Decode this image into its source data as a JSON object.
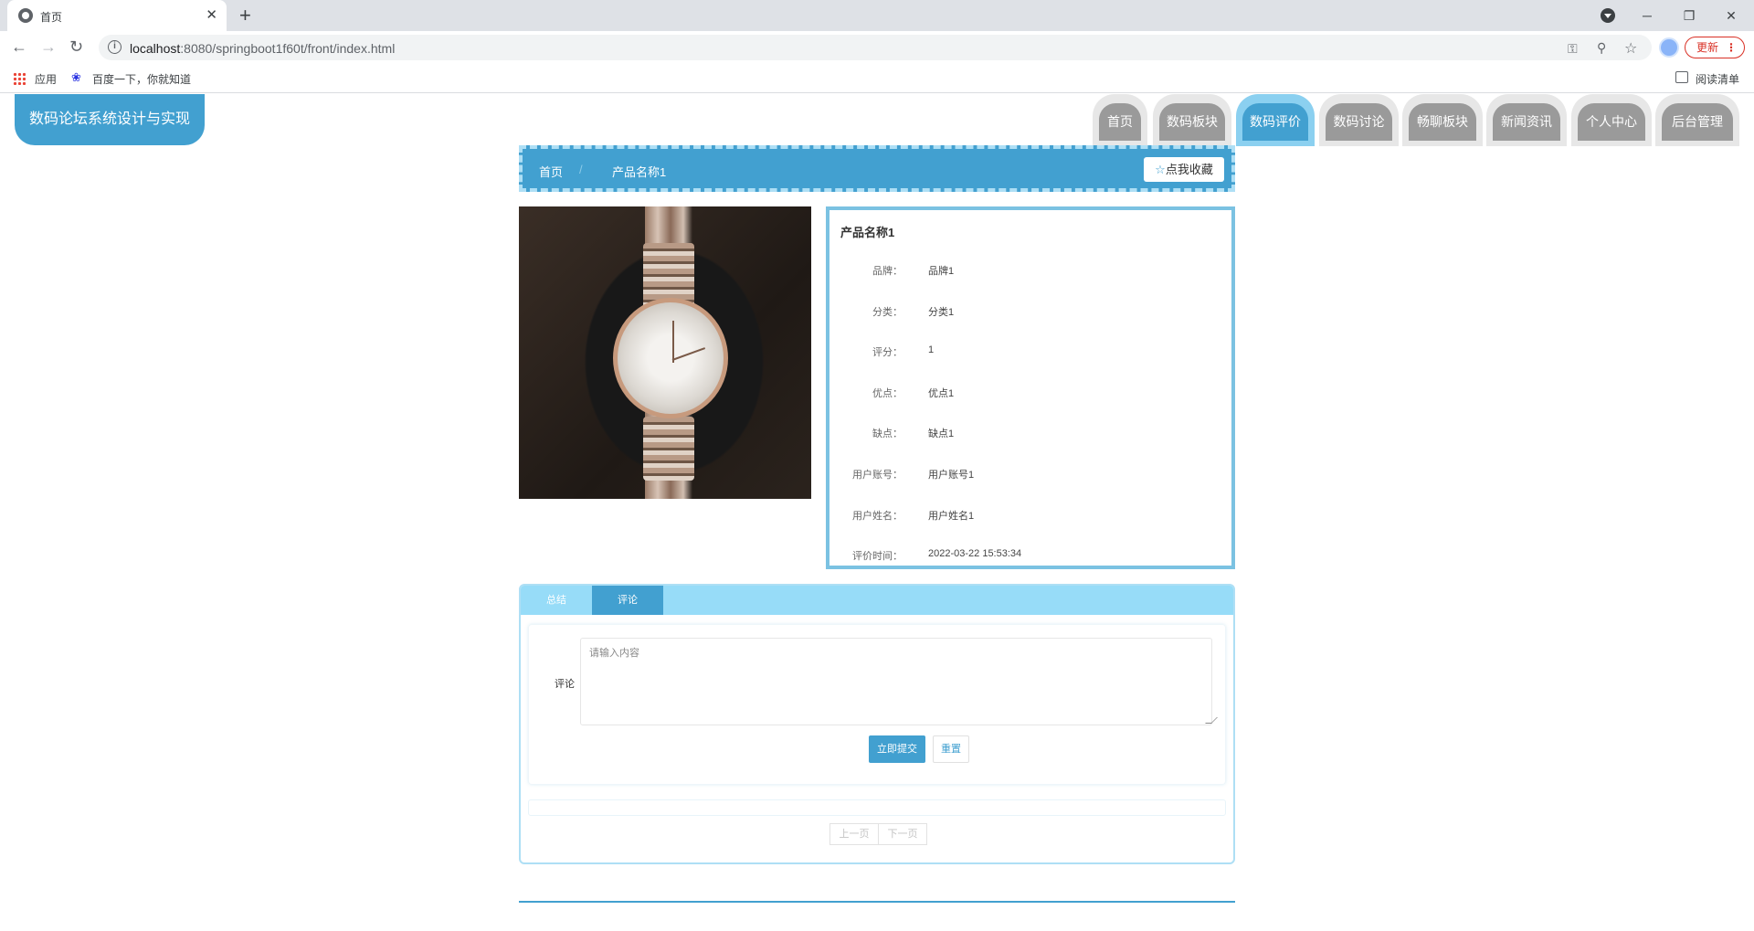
{
  "browser": {
    "tab_title": "首页",
    "url_host": "localhost",
    "url_rest": ":8080/springboot1f60t/front/index.html",
    "update_label": "更新",
    "bookmarks": [
      {
        "label": "应用"
      },
      {
        "label": "百度一下，你就知道"
      }
    ],
    "reading_list_label": "阅读清单"
  },
  "site": {
    "title": "数码论坛系统设计与实现"
  },
  "nav": {
    "items": [
      {
        "label": "首页",
        "active": false
      },
      {
        "label": "数码板块",
        "active": false
      },
      {
        "label": "数码评价",
        "active": true
      },
      {
        "label": "数码讨论",
        "active": false
      },
      {
        "label": "畅聊板块",
        "active": false
      },
      {
        "label": "新闻资讯",
        "active": false
      },
      {
        "label": "个人中心",
        "active": false
      },
      {
        "label": "后台管理",
        "active": false
      }
    ]
  },
  "breadcrumb": {
    "home": "首页",
    "separator": "/",
    "current": "产品名称1",
    "favorite_icon": "star-icon",
    "favorite_label": "点我收藏"
  },
  "product": {
    "name": "产品名称1",
    "fields": [
      {
        "label": "品牌：",
        "value": "品牌1"
      },
      {
        "label": "分类：",
        "value": "分类1"
      },
      {
        "label": "评分：",
        "value": "1"
      },
      {
        "label": "优点：",
        "value": "优点1"
      },
      {
        "label": "缺点：",
        "value": "缺点1"
      },
      {
        "label": "用户账号：",
        "value": "用户账号1"
      },
      {
        "label": "用户姓名：",
        "value": "用户姓名1"
      },
      {
        "label": "评价时间：",
        "value": "2022-03-22 15:53:34"
      }
    ]
  },
  "tabs": {
    "summary": "总结",
    "comment": "评论",
    "active": "comment"
  },
  "comment_form": {
    "label": "评论",
    "placeholder": "请输入内容",
    "value": "",
    "submit_label": "立即提交",
    "reset_label": "重置"
  },
  "pagination": {
    "prev_label": "上一页",
    "next_label": "下一页"
  },
  "colors": {
    "primary": "#42a0d0",
    "primary_light": "#97dcf8",
    "nav_inactive": "#9a9a9a",
    "border_light": "#aedff5"
  }
}
